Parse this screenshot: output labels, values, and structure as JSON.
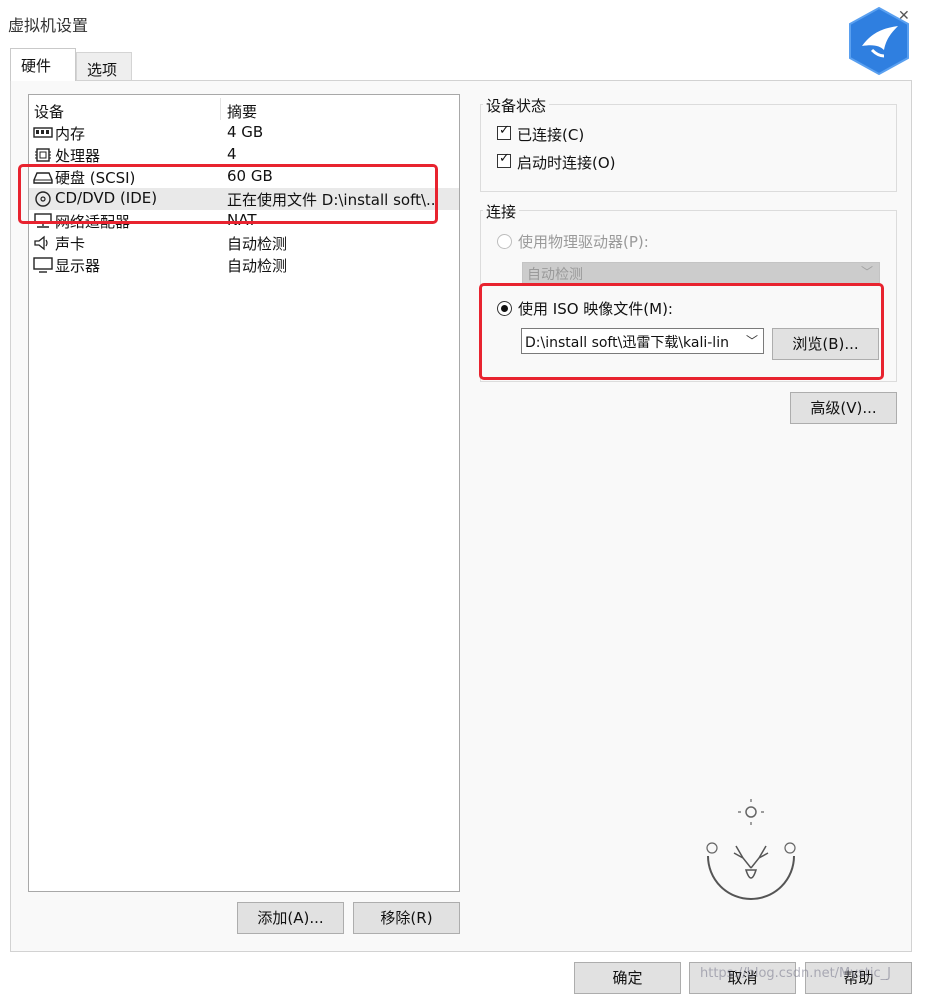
{
  "window": {
    "title": "虚拟机设置"
  },
  "tabs": [
    {
      "label": "硬件"
    },
    {
      "label": "选项"
    }
  ],
  "device_list": {
    "headers": {
      "device": "设备",
      "summary": "摘要"
    },
    "rows": [
      {
        "icon": "memory-icon",
        "name": "内存",
        "summary": "4 GB"
      },
      {
        "icon": "cpu-icon",
        "name": "处理器",
        "summary": "4"
      },
      {
        "icon": "harddisk-icon",
        "name": "硬盘 (SCSI)",
        "summary": "60 GB"
      },
      {
        "icon": "cd-dvd-icon",
        "name": "CD/DVD (IDE)",
        "summary": "正在使用文件 D:\\install soft\\.."
      },
      {
        "icon": "network-adapter-icon",
        "name": "网络适配器",
        "summary": "NAT"
      },
      {
        "icon": "sound-card-icon",
        "name": "声卡",
        "summary": "自动检测"
      },
      {
        "icon": "display-icon",
        "name": "显示器",
        "summary": "自动检测"
      }
    ],
    "selected_index": 3
  },
  "buttons": {
    "add": "添加(A)...",
    "remove": "移除(R)",
    "ok": "确定",
    "cancel": "取消",
    "help": "帮助"
  },
  "device_status": {
    "title": "设备状态",
    "connected": {
      "label": "已连接(C)",
      "checked": true
    },
    "connect_at_power_on": {
      "label": "启动时连接(O)",
      "checked": true
    }
  },
  "connection": {
    "title": "连接",
    "physical_drive": {
      "label": "使用物理驱动器(P):",
      "selected": false,
      "dropdown_value": "自动检测"
    },
    "iso_image": {
      "label": "使用 ISO 映像文件(M):",
      "selected": true,
      "path_value": "D:\\install soft\\迅雷下载\\kali-lin",
      "browse_label": "浏览(B)..."
    },
    "advanced_label": "高级(V)..."
  },
  "watermark": "https://blog.csdn.net/Mystic_J",
  "colors": {
    "highlight_red": "#e8232f",
    "logo_blue": "#2f7fe0"
  }
}
